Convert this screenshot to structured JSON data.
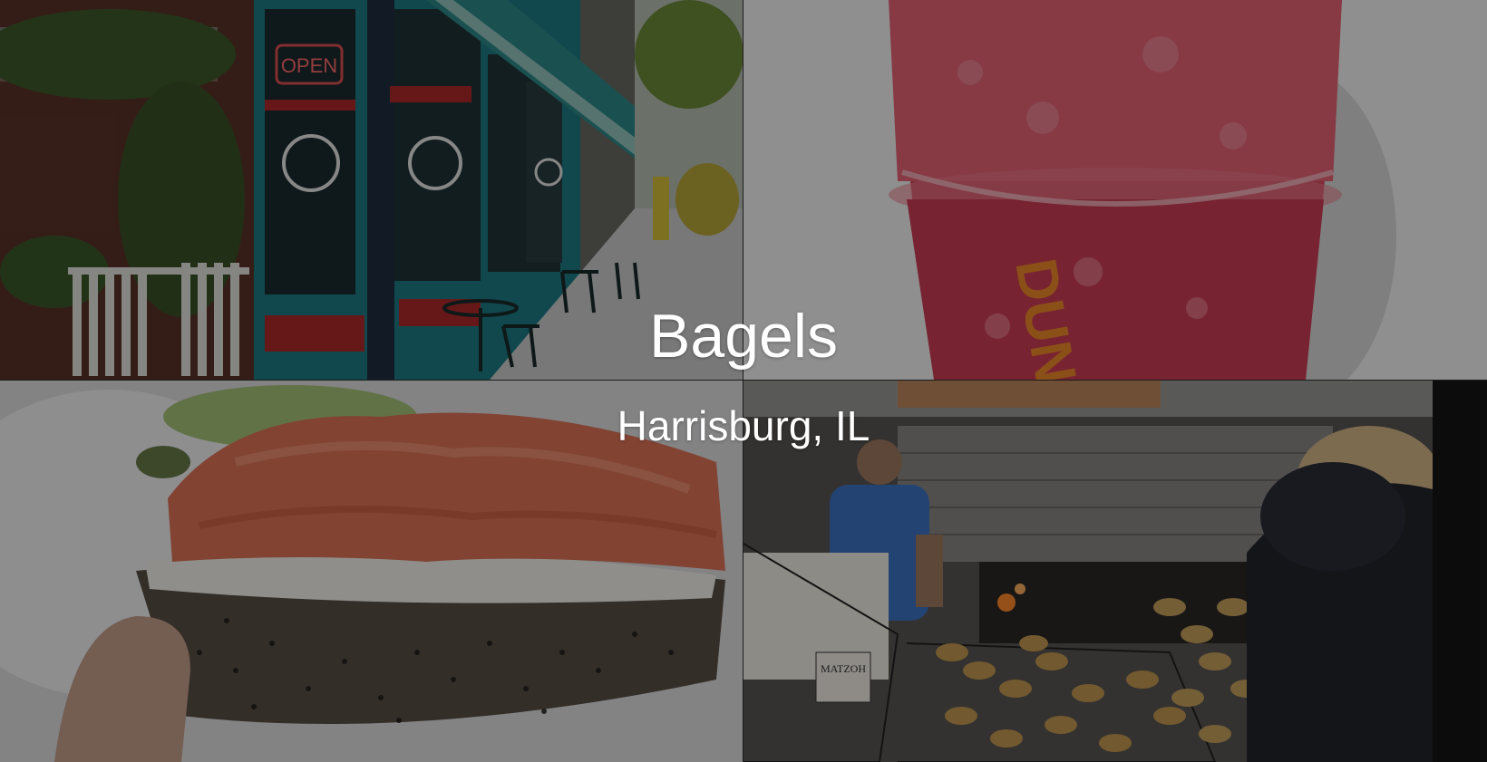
{
  "hero": {
    "title": "Bagels",
    "subtitle": "Harrisburg, IL"
  },
  "tiles": [
    {
      "name": "storefront-photo",
      "sign_text": "OPEN"
    },
    {
      "name": "smoothie-photo",
      "cup_text": "DUNK"
    },
    {
      "name": "lox-bagel-photo"
    },
    {
      "name": "bagel-shop-photo",
      "sign_text": "MATZOH"
    }
  ],
  "colors": {
    "overlay": "#000000",
    "text": "#ffffff"
  }
}
